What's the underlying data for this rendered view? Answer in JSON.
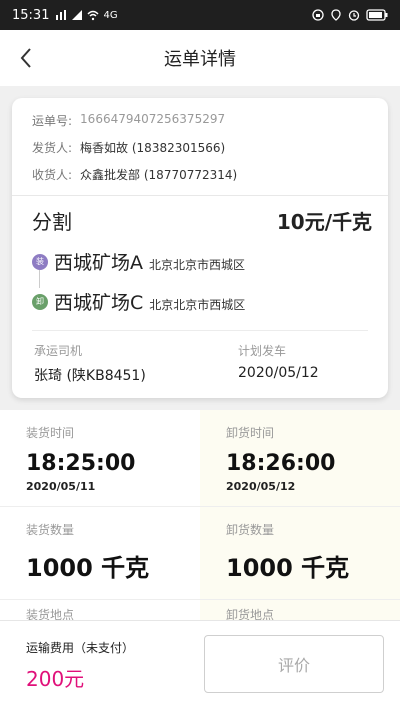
{
  "status_bar": {
    "time": "15:31",
    "network": "4G"
  },
  "header": {
    "title": "运单详情"
  },
  "waybill": {
    "number_label": "运单号:",
    "number": "1666479407256375297",
    "sender_label": "发货人:",
    "sender": "梅香如故 (18382301566)",
    "receiver_label": "收货人:",
    "receiver": "众鑫批发部 (18770772314)"
  },
  "goods": {
    "name": "分割",
    "price": "10元/千克"
  },
  "route": {
    "from": {
      "badge": "装",
      "place": "西城矿场A",
      "region": "北京北京市西城区",
      "color": "#8e7cc3"
    },
    "to": {
      "badge": "卸",
      "place": "西城矿场C",
      "region": "北京北京市西城区",
      "color": "#6aa06a"
    }
  },
  "driver": {
    "label": "承运司机",
    "value": "张琦 (陕KB8451)"
  },
  "plan": {
    "label": "计划发车",
    "value": "2020/05/12"
  },
  "loading": {
    "time_label": "装货时间",
    "time": "18:25:00",
    "date": "2020/05/11",
    "qty_label": "装货数量",
    "qty": "1000 千克",
    "place_label": "装货地点"
  },
  "unloading": {
    "time_label": "卸货时间",
    "time": "18:26:00",
    "date": "2020/05/12",
    "qty_label": "卸货数量",
    "qty": "1000 千克",
    "place_label": "卸货地点"
  },
  "footer": {
    "fee_label": "运输费用（未支付）",
    "fee": "200元",
    "rate_button": "评价",
    "fee_color": "#e0107a"
  }
}
